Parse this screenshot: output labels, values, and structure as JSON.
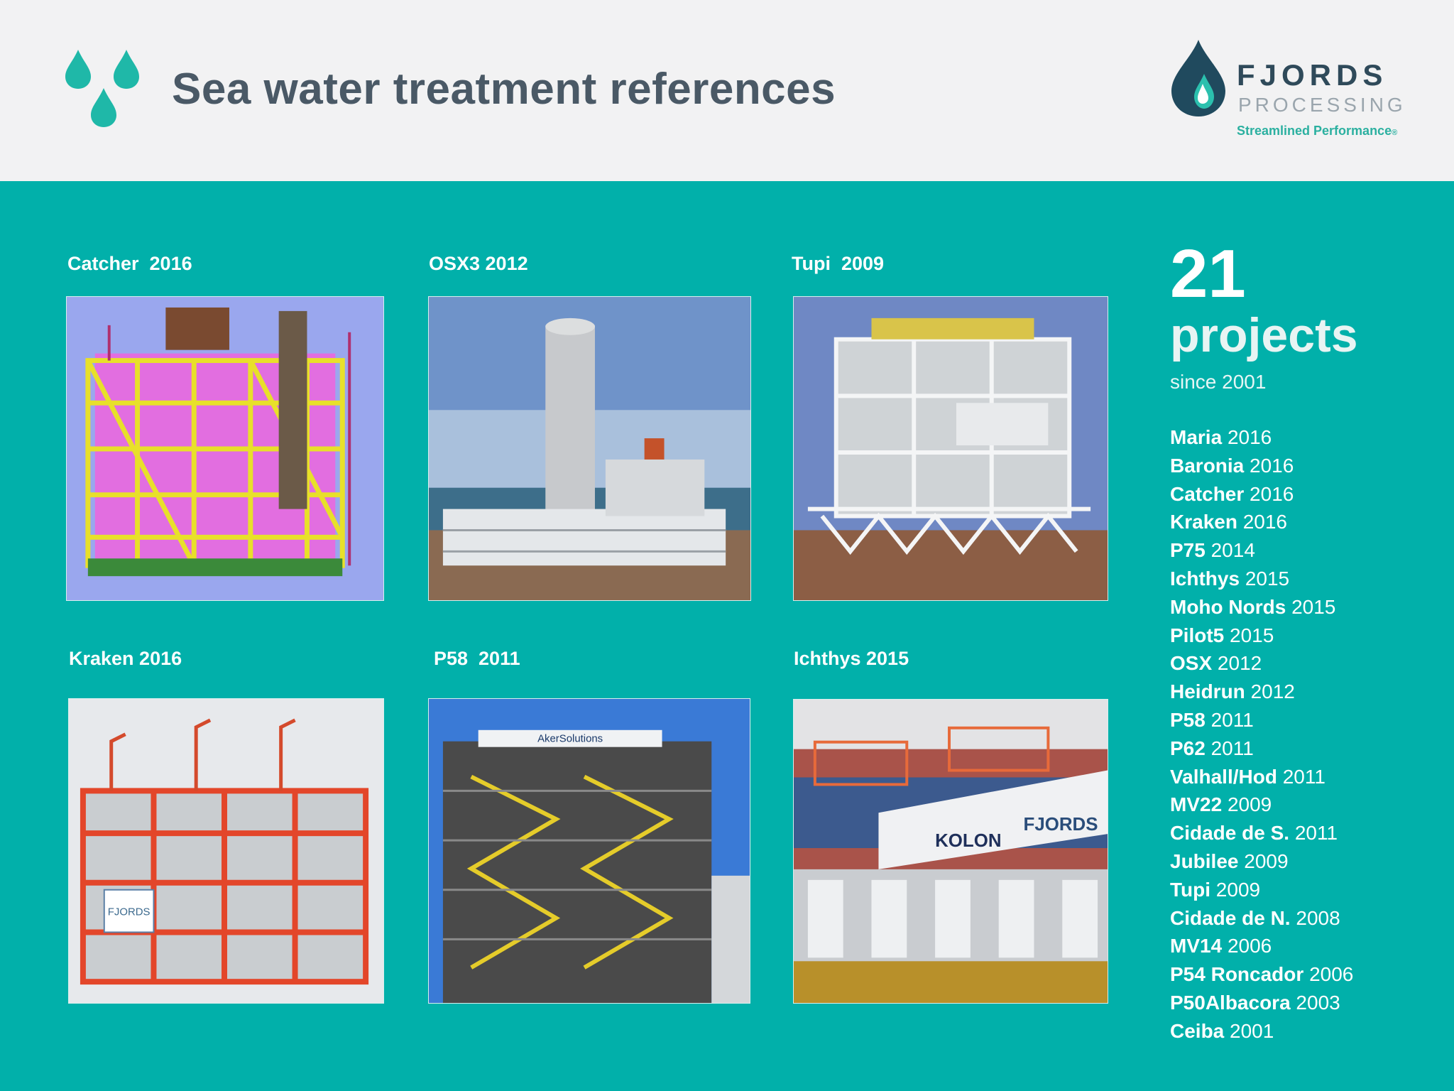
{
  "header": {
    "title": "Sea water treatment references",
    "logo": {
      "word": "FJORDS",
      "sub": "PROCESSING",
      "tagline": "Streamlined Performance",
      "mark": "®"
    },
    "icon": "water-drops-icon"
  },
  "colors": {
    "teal": "#01b0aa",
    "header_bg": "#f2f2f3",
    "title": "#4a5966",
    "logo_dark": "#2f4a5a",
    "logo_green": "#2bb0a0"
  },
  "cards": [
    {
      "label": "Catcher  2016",
      "photo": "Catcher 3D model render"
    },
    {
      "label": "OSX3 2012",
      "photo": "OSX3 module with tall column"
    },
    {
      "label": "Tupi  2009",
      "photo": "Tupi white structural module"
    },
    {
      "label": "Kraken 2016",
      "photo": "Kraken red module"
    },
    {
      "label": "P58  2011",
      "photo": "P58 module with yellow stairs"
    },
    {
      "label": "Ichthys 2015",
      "photo": "Ichthys module with Kolon and Fjords banner"
    }
  ],
  "banners": {
    "p58": "AkerSolutions",
    "kraken": "FJORDS",
    "ichthys_left": "KOLON",
    "ichthys_right": "FJORDS"
  },
  "summary": {
    "count": "21",
    "word": "projects",
    "since": "since 2001"
  },
  "projects": [
    {
      "name": "Maria",
      "year": "2016"
    },
    {
      "name": "Baronia",
      "year": "2016"
    },
    {
      "name": "Catcher",
      "year": "2016"
    },
    {
      "name": "Kraken",
      "year": "2016"
    },
    {
      "name": "P75",
      "year": "2014"
    },
    {
      "name": "Ichthys",
      "year": "2015"
    },
    {
      "name": "Moho Nords",
      "year": "2015"
    },
    {
      "name": "Pilot5",
      "year": "2015"
    },
    {
      "name": "OSX",
      "year": "2012"
    },
    {
      "name": "Heidrun",
      "year": "2012"
    },
    {
      "name": "P58",
      "year": "2011"
    },
    {
      "name": "P62",
      "year": "2011"
    },
    {
      "name": "Valhall/Hod",
      "year": "2011"
    },
    {
      "name": "MV22",
      "year": "2009"
    },
    {
      "name": "Cidade de S.",
      "year": "2011"
    },
    {
      "name": "Jubilee",
      "year": "2009"
    },
    {
      "name": "Tupi",
      "year": "2009"
    },
    {
      "name": "Cidade de N.",
      "year": "2008"
    },
    {
      "name": "MV14",
      "year": "2006"
    },
    {
      "name": "P54 Roncador",
      "year": "2006"
    },
    {
      "name": "P50Albacora",
      "year": "2003"
    },
    {
      "name": "Ceiba",
      "year": "2001"
    }
  ]
}
